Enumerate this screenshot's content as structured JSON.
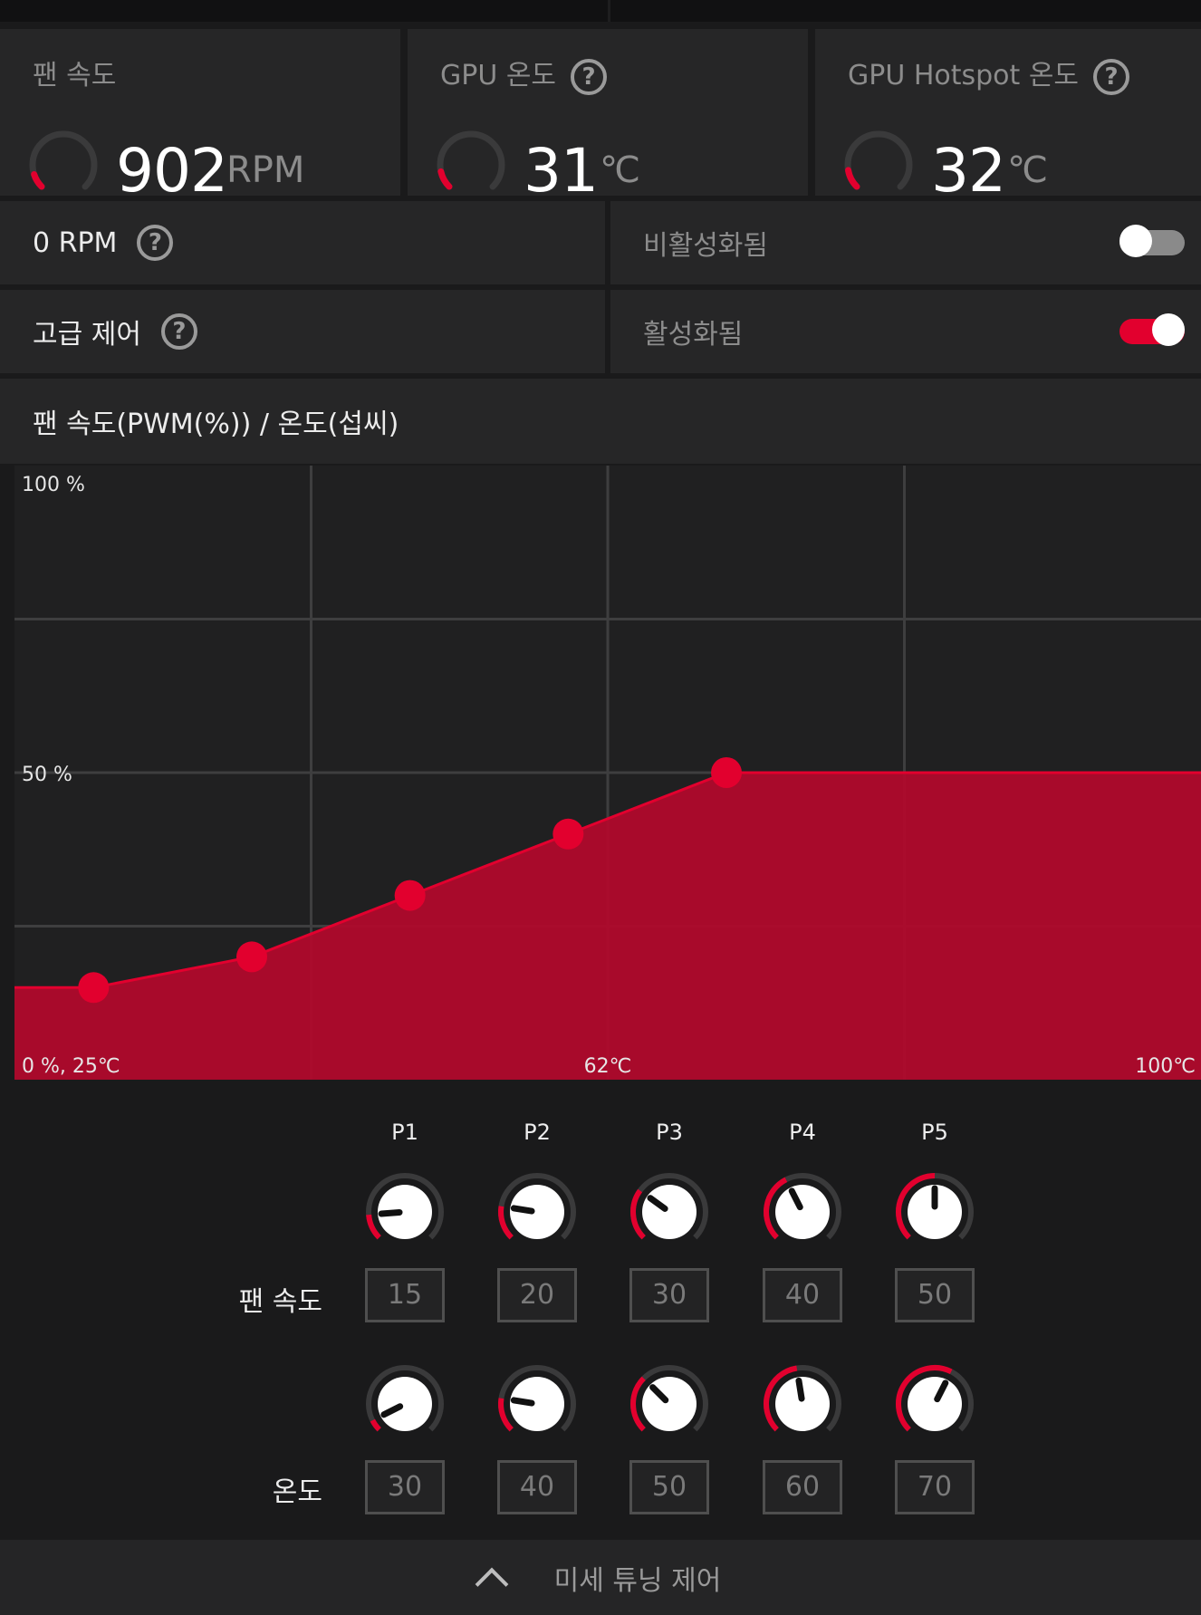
{
  "colors": {
    "accent": "#e2002e",
    "fill": "#b0092c",
    "background": "#1a1a1b",
    "card": "#262627"
  },
  "metrics": [
    {
      "label": "팬 속도",
      "value": "902",
      "unit": "RPM",
      "has_help": false,
      "gauge_fraction": 0.1
    },
    {
      "label": "GPU 온도",
      "value": "31",
      "unit": "℃",
      "has_help": true,
      "gauge_fraction": 0.12
    },
    {
      "label": "GPU Hotspot 온도",
      "value": "32",
      "unit": "℃",
      "has_help": true,
      "gauge_fraction": 0.13
    }
  ],
  "zero_rpm": {
    "label": "0 RPM",
    "state": "비활성화됨",
    "enabled": false
  },
  "advanced": {
    "label": "고급 제어",
    "state": "활성화됨",
    "enabled": true
  },
  "help_glyph": "?",
  "chart_title": "팬 속도(PWM(%)) / 온도(섭씨)",
  "chart_data": {
    "type": "area",
    "title": "팬 속도(PWM(%)) / 온도(섭씨)",
    "xlabel": "",
    "ylabel": "",
    "xlim": [
      25,
      100
    ],
    "ylim": [
      0,
      100
    ],
    "grid": true,
    "tick_labels": {
      "top_left": "100 %",
      "mid_left": "50 %",
      "origin": "0 %, 25℃",
      "x_mid": "62℃",
      "x_max": "100℃"
    },
    "points": [
      {
        "name": "P1",
        "temp": 30,
        "pwm": 15
      },
      {
        "name": "P2",
        "temp": 40,
        "pwm": 20
      },
      {
        "name": "P3",
        "temp": 50,
        "pwm": 30
      },
      {
        "name": "P4",
        "temp": 60,
        "pwm": 40
      },
      {
        "name": "P5",
        "temp": 70,
        "pwm": 50
      }
    ]
  },
  "tuning": {
    "points": [
      "P1",
      "P2",
      "P3",
      "P4",
      "P5"
    ],
    "fan_label": "팬 속도",
    "temp_label": "온도",
    "fan_values": [
      "15",
      "20",
      "30",
      "40",
      "50"
    ],
    "temp_values": [
      "30",
      "40",
      "50",
      "60",
      "70"
    ]
  },
  "footer": {
    "label": "미세 튜닝 제어",
    "icon": "chevron-up-icon"
  }
}
